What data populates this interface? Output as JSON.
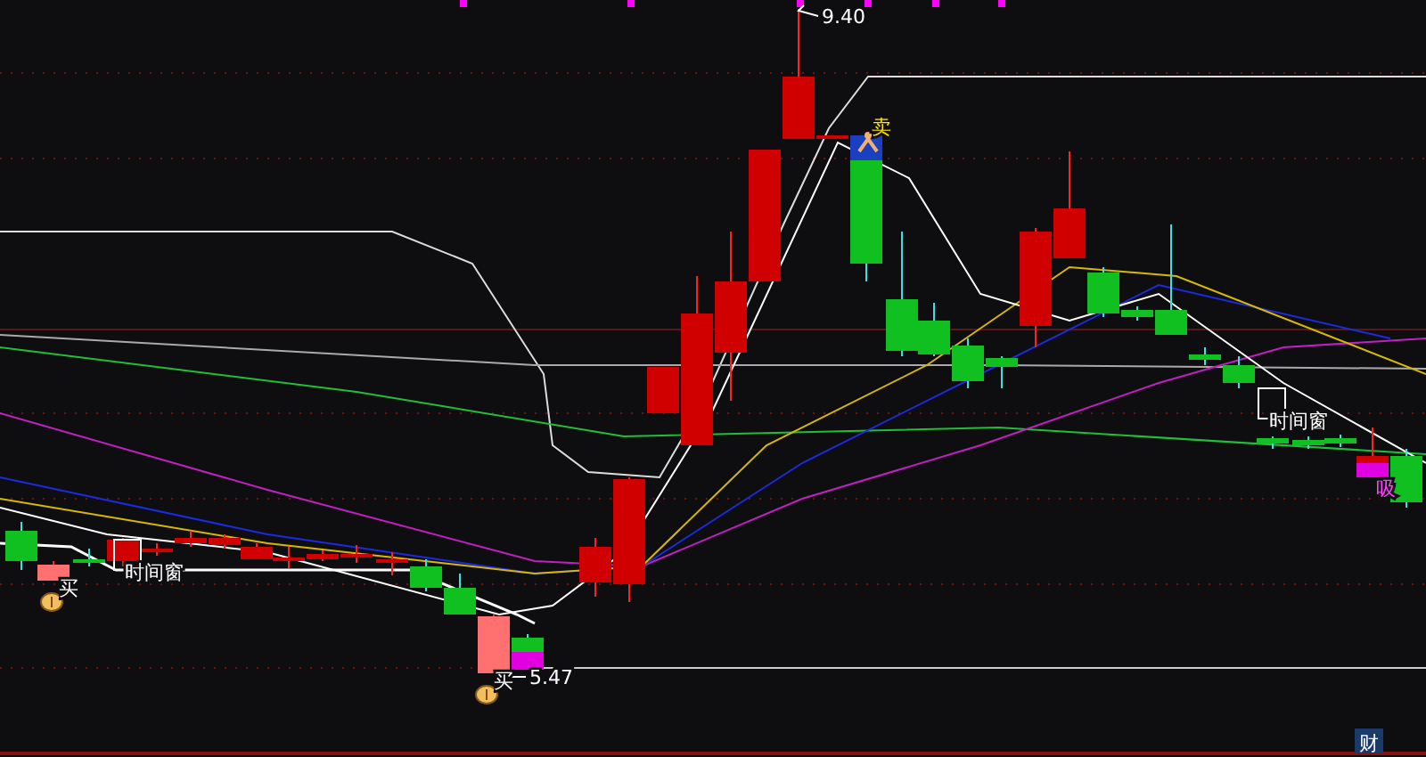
{
  "chart": {
    "price_labels": [
      {
        "kind": "high",
        "text": "9.40"
      },
      {
        "kind": "low",
        "text": "5.47"
      }
    ],
    "signals": [
      {
        "kind": "buy",
        "text": "买"
      },
      {
        "kind": "time-window",
        "text": "时间窗"
      },
      {
        "kind": "buy",
        "text": "买"
      },
      {
        "kind": "sell",
        "text": "卖"
      },
      {
        "kind": "time-window",
        "text": "时间窗"
      },
      {
        "kind": "absorb",
        "text": "吸"
      },
      {
        "kind": "finance",
        "text": "财"
      }
    ]
  }
}
